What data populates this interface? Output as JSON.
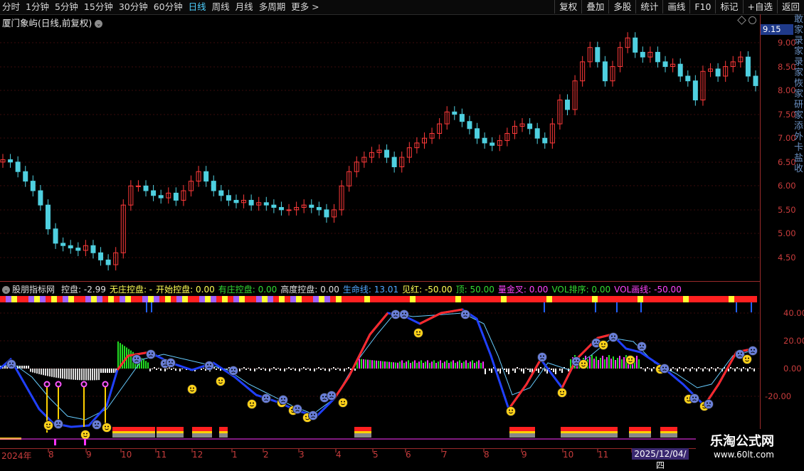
{
  "toolbar": {
    "tabs": [
      "分时",
      "1分钟",
      "5分钟",
      "15分钟",
      "30分钟",
      "60分钟",
      "日线",
      "周线",
      "月线",
      "多周期",
      "更多 >"
    ],
    "active_tab": "日线",
    "tools": [
      "复权",
      "叠加",
      "多股",
      "统计",
      "画线",
      "F10",
      "标记",
      "+自选",
      "返回"
    ]
  },
  "chart_header": {
    "stock_title": "厦门象屿(日线,前复权)",
    "current_price": "9.15"
  },
  "price_axis_labels": [
    "9.00",
    "8.50",
    "8.00",
    "7.50",
    "7.00",
    "6.50",
    "6.00",
    "5.50",
    "5.00",
    "4.50"
  ],
  "indicator_header": {
    "name": "股朋指标网",
    "items": [
      {
        "text": "控盘: -2.99",
        "color": "#e0e0e0"
      },
      {
        "text": "无庄控盘: -",
        "color": "#ffff55"
      },
      {
        "text": "开始控盘: 0.00",
        "color": "#ffff55"
      },
      {
        "text": "有庄控盘: 0.00",
        "color": "#33dd33"
      },
      {
        "text": "高度控盘: 0.00",
        "color": "#e0e0e0"
      },
      {
        "text": "生命线: 13.01",
        "color": "#4fa8ff"
      },
      {
        "text": "见红: -50.00",
        "color": "#ffff55"
      },
      {
        "text": "顶: 50.00",
        "color": "#33dd33"
      },
      {
        "text": "量金叉: 0.00",
        "color": "#ff44ff"
      },
      {
        "text": "VOL排序: 0.00",
        "color": "#33dd33"
      },
      {
        "text": "VOL画线: -50.00",
        "color": "#ff44ff"
      }
    ]
  },
  "indicator_axis_labels": [
    "40.00",
    "20.00",
    "0.00",
    "-20.00"
  ],
  "time_axis": [
    "2024年",
    "8",
    "9",
    "10",
    "11",
    "12",
    "1",
    "2",
    "3",
    "4",
    "5",
    "6",
    "7",
    "8",
    "9",
    "10",
    "11"
  ],
  "selected_date": "2025/12/04/四",
  "watermark": {
    "title": "乐淘公式网",
    "url": "www.60lt.com"
  },
  "right_strip_text": "敢家录家录家恢家研家添外卡盐收",
  "colors": {
    "up": "#ff3a3a",
    "down": "#4fd0e0",
    "axis": "#c83c3c",
    "life_line": "#4fa8ff"
  },
  "chart_data": {
    "type": "candlestick",
    "ylim": [
      4.2,
      9.3
    ],
    "closes": [
      6.55,
      6.5,
      6.3,
      6.1,
      5.9,
      5.6,
      5.1,
      4.8,
      4.75,
      4.7,
      4.65,
      4.75,
      4.6,
      4.45,
      4.35,
      4.6,
      5.6,
      6.0,
      6.0,
      5.9,
      5.8,
      5.75,
      5.85,
      5.7,
      5.9,
      6.1,
      6.3,
      6.1,
      5.9,
      5.8,
      5.7,
      5.65,
      5.7,
      5.6,
      5.65,
      5.6,
      5.55,
      5.5,
      5.5,
      5.55,
      5.6,
      5.55,
      5.5,
      5.35,
      5.5,
      6.0,
      6.3,
      6.5,
      6.6,
      6.7,
      6.75,
      6.6,
      6.4,
      6.6,
      6.8,
      6.9,
      7.0,
      7.1,
      7.3,
      7.55,
      7.5,
      7.35,
      7.2,
      7.0,
      6.9,
      6.85,
      6.95,
      7.1,
      7.25,
      7.3,
      7.2,
      7.0,
      6.9,
      7.3,
      7.8,
      7.6,
      8.2,
      8.6,
      8.9,
      8.6,
      8.2,
      8.5,
      8.9,
      9.1,
      8.8,
      8.7,
      8.8,
      8.6,
      8.5,
      8.55,
      8.3,
      8.2,
      7.8,
      8.4,
      8.45,
      8.3,
      8.5,
      8.6,
      8.7,
      8.3,
      8.1
    ]
  }
}
